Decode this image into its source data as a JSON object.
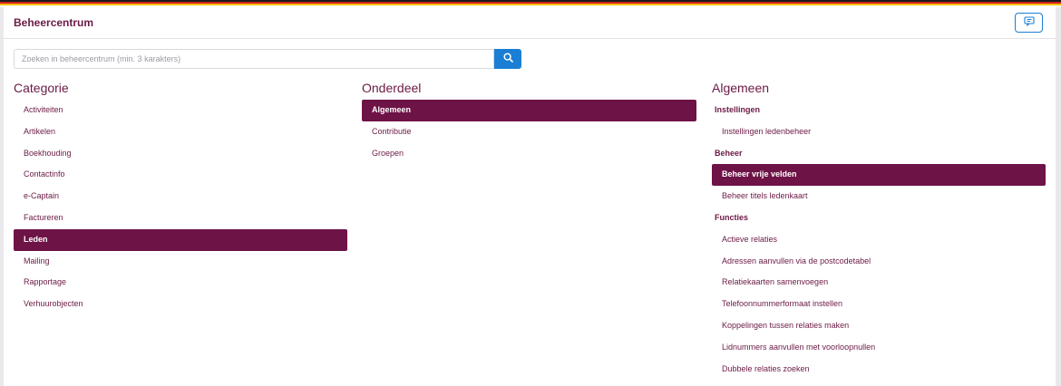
{
  "header": {
    "title": "Beheercentrum",
    "feedback_icon": "chat-icon"
  },
  "search": {
    "placeholder": "Zoeken in beheercentrum (min. 3 karakters)",
    "value": "",
    "icon": "search-icon"
  },
  "colors": {
    "accent": "#6e1346",
    "button": "#1a7fd4"
  },
  "categorie": {
    "title": "Categorie",
    "items": [
      {
        "label": "Activiteiten",
        "selected": false
      },
      {
        "label": "Artikelen",
        "selected": false
      },
      {
        "label": "Boekhouding",
        "selected": false
      },
      {
        "label": "Contactinfo",
        "selected": false
      },
      {
        "label": "e-Captain",
        "selected": false
      },
      {
        "label": "Factureren",
        "selected": false
      },
      {
        "label": "Leden",
        "selected": true
      },
      {
        "label": "Mailing",
        "selected": false
      },
      {
        "label": "Rapportage",
        "selected": false
      },
      {
        "label": "Verhuurobjecten",
        "selected": false
      }
    ]
  },
  "onderdeel": {
    "title": "Onderdeel",
    "items": [
      {
        "label": "Algemeen",
        "selected": true
      },
      {
        "label": "Contributie",
        "selected": false
      },
      {
        "label": "Groepen",
        "selected": false
      }
    ]
  },
  "algemeen": {
    "title": "Algemeen",
    "sections": [
      {
        "heading": "Instellingen",
        "items": [
          {
            "label": "Instellingen ledenbeheer",
            "selected": false
          }
        ]
      },
      {
        "heading": "Beheer",
        "items": [
          {
            "label": "Beheer vrije velden",
            "selected": true
          },
          {
            "label": "Beheer titels ledenkaart",
            "selected": false
          }
        ]
      },
      {
        "heading": "Functies",
        "items": [
          {
            "label": "Actieve relaties",
            "selected": false
          },
          {
            "label": "Adressen aanvullen via de postcodetabel",
            "selected": false
          },
          {
            "label": "Relatiekaarten samenvoegen",
            "selected": false
          },
          {
            "label": "Telefoonnummerformaat instellen",
            "selected": false
          },
          {
            "label": "Koppelingen tussen relaties maken",
            "selected": false
          },
          {
            "label": "Lidnummers aanvullen met voorloopnullen",
            "selected": false
          },
          {
            "label": "Dubbele relaties zoeken",
            "selected": false
          }
        ]
      }
    ]
  }
}
